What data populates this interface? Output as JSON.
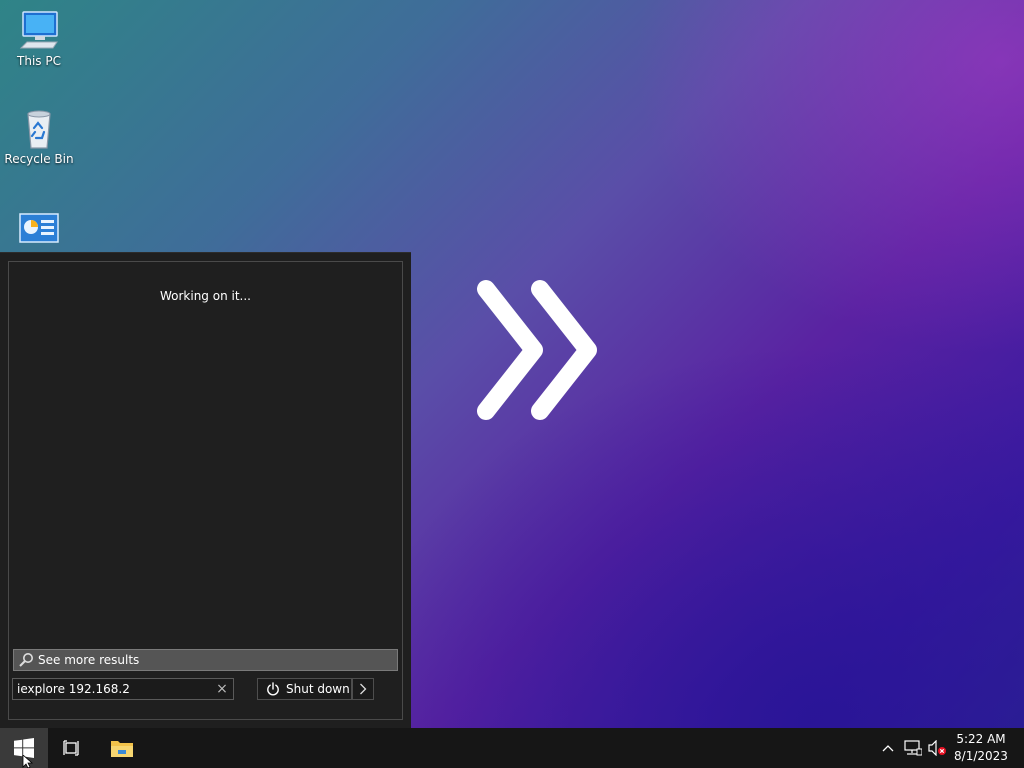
{
  "desktop": {
    "icons": [
      {
        "label": "This PC",
        "icon": "computer-icon"
      },
      {
        "label": "Recycle Bin",
        "icon": "recycle-bin-icon"
      },
      {
        "label": "",
        "icon": "control-panel-icon"
      }
    ]
  },
  "search_panel": {
    "status_text": "Working on it...",
    "see_more_label": "See more results",
    "search_query": "iexplore 192.168.2",
    "clear_icon": "×",
    "shutdown_label": "Shut down"
  },
  "taskbar": {
    "items": [
      "start-icon",
      "task-view-icon",
      "file-explorer-icon"
    ],
    "tray_icons": [
      "chevron-up-icon",
      "network-icon",
      "volume-muted-icon"
    ],
    "time": "5:22 AM",
    "date": "8/1/2023"
  },
  "colors": {
    "taskbar": "#161616",
    "panel": "#1f1f1f",
    "folder": "#f2c24a",
    "muted_badge": "#e81123"
  }
}
